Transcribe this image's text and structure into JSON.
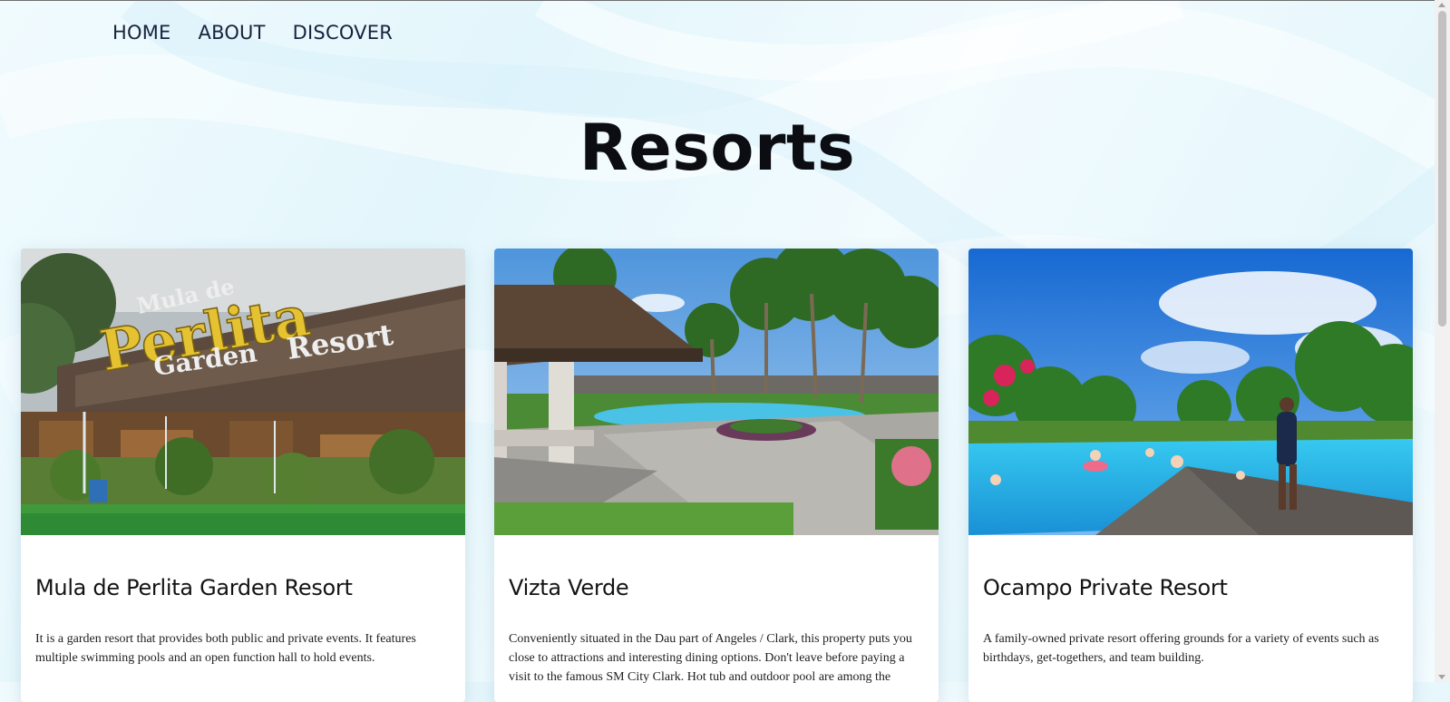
{
  "nav": {
    "items": [
      {
        "label": "HOME"
      },
      {
        "label": "ABOUT"
      },
      {
        "label": "DISCOVER"
      }
    ]
  },
  "page": {
    "title": "Resorts"
  },
  "cards": [
    {
      "title": "Mula de Perlita Garden Resort",
      "description": "It is a garden resort that provides both public and private events. It features multiple swimming pools and an open function hall to hold events.",
      "photo": {
        "sign_line1": "Mula de",
        "sign_line2": "Perlita",
        "sign_line3": "Garden",
        "sign_line4": "Resort"
      }
    },
    {
      "title": "Vizta Verde",
      "description": "Conveniently situated in the Dau part of Angeles / Clark, this property puts you close to attractions and interesting dining options. Don't leave before paying a visit to the famous SM City Clark. Hot tub and outdoor pool are among the"
    },
    {
      "title": "Ocampo Private Resort",
      "description": "A family-owned private resort offering grounds for a variety of events such as birthdays, get-togethers, and team building."
    }
  ],
  "colors": {
    "nav_text": "#18233d",
    "title_text": "#0b0d12",
    "pool_water": "#2fb9e6",
    "sign_gold": "#e4c232"
  }
}
